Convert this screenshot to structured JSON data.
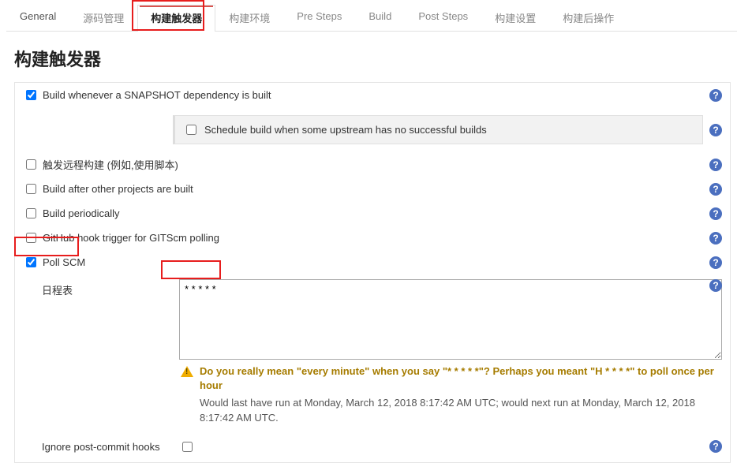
{
  "tabs": {
    "t0": "General",
    "t1": "源码管理",
    "t2": "构建触发器",
    "t3": "构建环境",
    "t4": "Pre Steps",
    "t5": "Build",
    "t6": "Post Steps",
    "t7": "构建设置",
    "t8": "构建后操作"
  },
  "section_title": "构建触发器",
  "rows": {
    "snapshot": "Build whenever a SNAPSHOT dependency is built",
    "upstream": "Schedule build when some upstream has no successful builds",
    "remote": "触发远程构建 (例如,使用脚本)",
    "after": "Build after other projects are built",
    "periodic": "Build periodically",
    "github": "GitHub hook trigger for GITScm polling",
    "poll": "Poll SCM",
    "schedule_label": "日程表",
    "schedule_value": "* * * * *",
    "ignore_label": "Ignore post-commit hooks"
  },
  "warning": {
    "head": "Do you really mean \"every minute\" when you say \"* * * * *\"? Perhaps you meant \"H * * * *\" to poll once per hour",
    "body": "Would last have run at Monday, March 12, 2018 8:17:42 AM UTC; would next run at Monday, March 12, 2018 8:17:42 AM UTC."
  }
}
